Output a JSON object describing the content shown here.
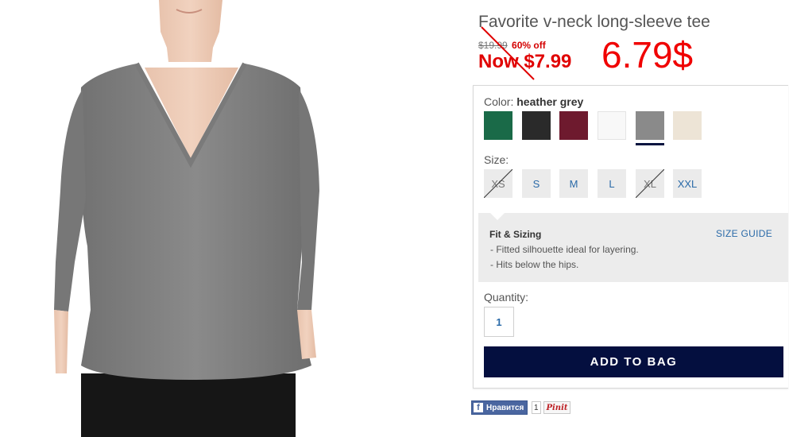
{
  "product": {
    "title": "Favorite v-neck long-sleeve tee",
    "original_price": "$19.99",
    "discount": "60% off",
    "now_price": "Now $7.99",
    "handwritten_price": "6.79$"
  },
  "color": {
    "label": "Color:",
    "selected": "heather grey",
    "swatches": [
      {
        "name": "green",
        "hex": "#1a6a48"
      },
      {
        "name": "black",
        "hex": "#2a2a2a"
      },
      {
        "name": "burgundy",
        "hex": "#6e1a2e"
      },
      {
        "name": "white",
        "hex": "#f8f8f8"
      },
      {
        "name": "heather grey",
        "hex": "#8a8a8a"
      },
      {
        "name": "cream",
        "hex": "#ede4d6"
      }
    ]
  },
  "size": {
    "label": "Size:",
    "options": [
      {
        "label": "XS",
        "available": false
      },
      {
        "label": "S",
        "available": true
      },
      {
        "label": "M",
        "available": true
      },
      {
        "label": "L",
        "available": true
      },
      {
        "label": "XL",
        "available": false
      },
      {
        "label": "XXL",
        "available": true
      }
    ]
  },
  "fit": {
    "title": "Fit & Sizing",
    "size_guide": "SIZE GUIDE",
    "bullets": [
      "- Fitted silhouette ideal for layering.",
      "- Hits below the hips."
    ]
  },
  "quantity": {
    "label": "Quantity:",
    "value": "1"
  },
  "add_to_bag": "ADD TO BAG",
  "social": {
    "like_label": "Нравится",
    "like_count": "1",
    "pin_label": "Pinit"
  },
  "colors": {
    "accent_red": "#e00000",
    "navy": "#040f3f",
    "link_blue": "#2a6aa8"
  }
}
